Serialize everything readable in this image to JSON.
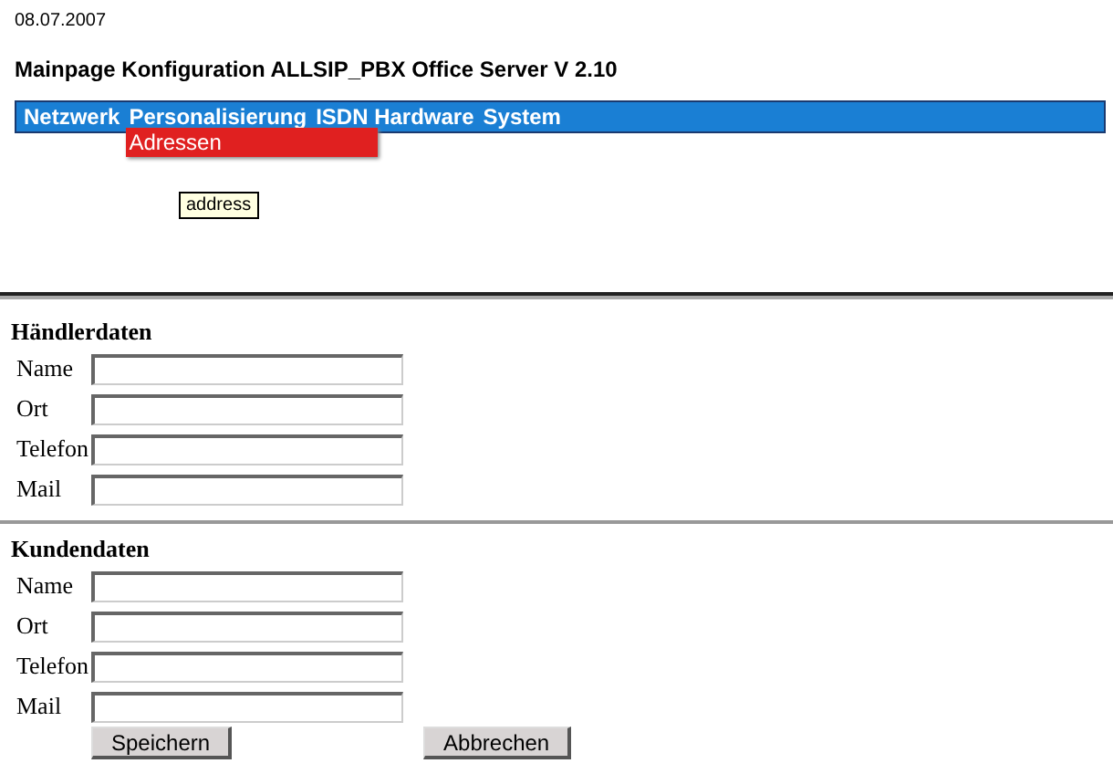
{
  "date": "08.07.2007",
  "title": "Mainpage Konfiguration ALLSIP_PBX Office Server V 2.10",
  "menu": [
    {
      "label": "Netzwerk"
    },
    {
      "label": "Personalisierung",
      "dropdown": [
        {
          "label": "Adressen",
          "selected": true
        }
      ]
    },
    {
      "label": "ISDN Hardware"
    },
    {
      "label": "System"
    }
  ],
  "tooltip": "address",
  "sections": [
    {
      "heading": "Händlerdaten",
      "fields": [
        {
          "label": "Name"
        },
        {
          "label": "Ort"
        },
        {
          "label": "Telefon"
        },
        {
          "label": "Mail"
        }
      ]
    },
    {
      "heading": "Kundendaten",
      "fields": [
        {
          "label": "Name"
        },
        {
          "label": "Ort"
        },
        {
          "label": "Telefon"
        },
        {
          "label": "Mail"
        }
      ]
    }
  ],
  "buttons": [
    "Speichern",
    "Abbrechen"
  ]
}
